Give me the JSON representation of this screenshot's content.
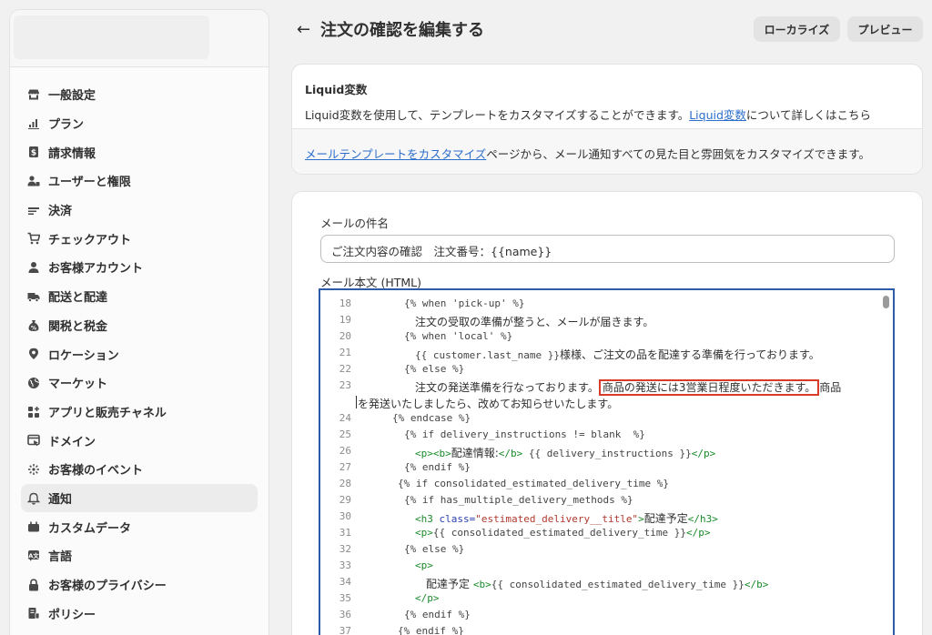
{
  "sidebar": {
    "items": [
      {
        "label": "一般設定",
        "icon": "store-icon"
      },
      {
        "label": "プラン",
        "icon": "plan-icon"
      },
      {
        "label": "請求情報",
        "icon": "billing-icon"
      },
      {
        "label": "ユーザーと権限",
        "icon": "users-icon"
      },
      {
        "label": "決済",
        "icon": "payments-icon"
      },
      {
        "label": "チェックアウト",
        "icon": "cart-icon"
      },
      {
        "label": "お客様アカウント",
        "icon": "person-icon"
      },
      {
        "label": "配送と配達",
        "icon": "truck-icon"
      },
      {
        "label": "関税と税金",
        "icon": "tax-icon"
      },
      {
        "label": "ロケーション",
        "icon": "location-icon"
      },
      {
        "label": "マーケット",
        "icon": "globe-icon"
      },
      {
        "label": "アプリと販売チャネル",
        "icon": "apps-icon"
      },
      {
        "label": "ドメイン",
        "icon": "domain-icon"
      },
      {
        "label": "お客様のイベント",
        "icon": "events-icon"
      },
      {
        "label": "通知",
        "icon": "bell-icon",
        "active": true
      },
      {
        "label": "カスタムデータ",
        "icon": "custom-data-icon"
      },
      {
        "label": "言語",
        "icon": "language-icon"
      },
      {
        "label": "お客様のプライバシー",
        "icon": "lock-icon"
      },
      {
        "label": "ポリシー",
        "icon": "policy-icon"
      }
    ]
  },
  "header": {
    "title": "注文の確認を編集する",
    "localize_label": "ローカライズ",
    "preview_label": "プレビュー"
  },
  "liquid_card": {
    "title": "Liquid変数",
    "desc_prefix": "Liquid変数を使用して、テンプレートをカスタマイズすることができます。",
    "desc_link": "Liquid変数",
    "desc_suffix": "について詳しくはこちら",
    "footer_link": "メールテンプレートをカスタマイズ",
    "footer_suffix": "ページから、メール通知すべての見た目と雰囲気をカスタマイズできます。"
  },
  "email_card": {
    "subject_label": "メールの件名",
    "subject_value": "ご注文内容の確認　注文番号：{{name}}",
    "body_label": "メール本文 (HTML)"
  },
  "editor": {
    "lines": {
      "l18": {
        "n": "18",
        "code": "{% when 'pick-up' %}"
      },
      "l19": {
        "n": "19",
        "text": "注文の受取の準備が整うと、メールが届きます。"
      },
      "l20": {
        "n": "20",
        "code": "{% when 'local' %}"
      },
      "l21": {
        "n": "21",
        "code": "{{ customer.last_name }}",
        "text": "様様、ご注文の品を配達する準備を行っております。"
      },
      "l22": {
        "n": "22",
        "code": "{% else %}"
      },
      "l23": {
        "n": "23",
        "text_a": "注文の発送準備を行なっております。",
        "highlight": "商品の発送には3営業日程度いただきます。",
        "text_b": "商品",
        "wrap": "を発送いたしましたら、改めてお知らせいたします。"
      },
      "l24": {
        "n": "24",
        "code": "{% endcase %}"
      },
      "l25": {
        "n": "25",
        "code": "{% if delivery_instructions != blank  %}"
      },
      "l26": {
        "n": "26",
        "tag_open": "<p><b>",
        "text": "配達情報:",
        "tag_close": "</b>",
        "code": " {{ delivery_instructions }}",
        "tag_end": "</p>"
      },
      "l27": {
        "n": "27",
        "code": "{% endif %}"
      },
      "l28": {
        "n": "28",
        "code": "{% if consolidated_estimated_delivery_time %}"
      },
      "l29": {
        "n": "29",
        "code": "{% if has_multiple_delivery_methods %}"
      },
      "l30": {
        "n": "30",
        "tag_open": "<h3 ",
        "attr": "class=",
        "str": "\"estimated_delivery__title\"",
        "tag_gt": ">",
        "text": "配達予定",
        "tag_close": "</h3>"
      },
      "l31": {
        "n": "31",
        "tag_open": "<p>",
        "code": "{{ consolidated_estimated_delivery_time }}",
        "tag_close": "</p>"
      },
      "l32": {
        "n": "32",
        "code": "{% else %}"
      },
      "l33": {
        "n": "33",
        "tag_open": "<p>"
      },
      "l34": {
        "n": "34",
        "text": "配達予定 ",
        "tag_open": "<b>",
        "code": "{{ consolidated_estimated_delivery_time }}",
        "tag_close": "</b>"
      },
      "l35": {
        "n": "35",
        "tag_open": "</p>"
      },
      "l36": {
        "n": "36",
        "code": "{% endif %}"
      },
      "l37": {
        "n": "37",
        "code": "{% endif %}"
      }
    }
  }
}
